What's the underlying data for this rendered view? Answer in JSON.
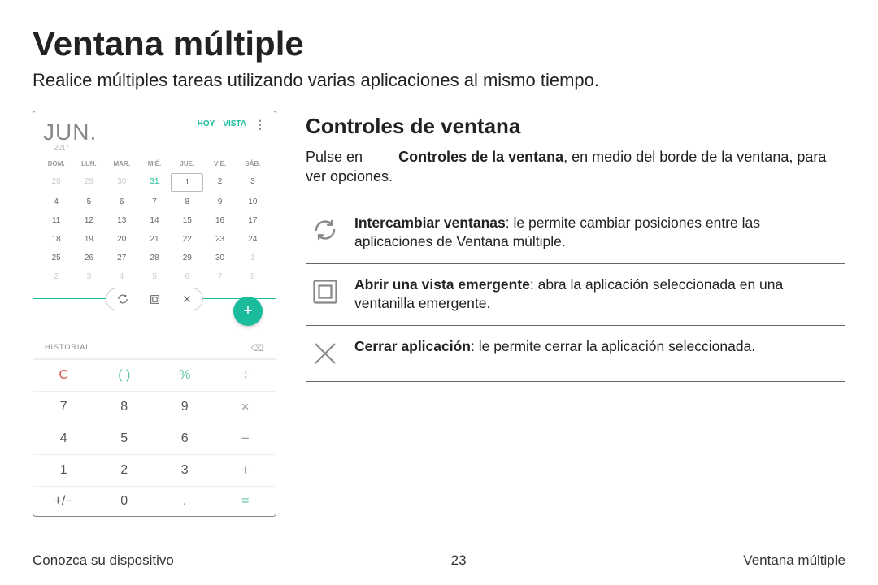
{
  "page": {
    "title": "Ventana múltiple",
    "subtitle": "Realice múltiples tareas utilizando varias aplicaciones al mismo tiempo."
  },
  "section": {
    "title": "Controles de ventana",
    "intro_prefix": "Pulse en ",
    "intro_bold": "Controles de la ventana",
    "intro_suffix": ", en medio del borde de la ventana, para ver opciones."
  },
  "features": [
    {
      "title": "Intercambiar ventanas",
      "desc": ": le permite cambiar posiciones entre las aplicaciones de Ventana múltiple."
    },
    {
      "title": "Abrir una vista emergente",
      "desc": ": abra la aplicación seleccionada en una ventanilla emergente."
    },
    {
      "title": "Cerrar aplicación",
      "desc": ": le permite cerrar la aplicación seleccionada."
    }
  ],
  "phone": {
    "calendar": {
      "month": "JUN.",
      "year": "2017",
      "btn_today": "HOY",
      "btn_view": "VISTA",
      "dow": [
        "DOM.",
        "LUN.",
        "MAR.",
        "MIÉ.",
        "JUE.",
        "VIE.",
        "SÁB."
      ],
      "weeks": [
        [
          "28",
          "29",
          "30",
          "31",
          "1",
          "2",
          "3"
        ],
        [
          "4",
          "5",
          "6",
          "7",
          "8",
          "9",
          "10"
        ],
        [
          "11",
          "12",
          "13",
          "14",
          "15",
          "16",
          "17"
        ],
        [
          "18",
          "19",
          "20",
          "21",
          "22",
          "23",
          "24"
        ],
        [
          "25",
          "26",
          "27",
          "28",
          "29",
          "30",
          "1"
        ],
        [
          "2",
          "3",
          "4",
          "5",
          "6",
          "7",
          "8"
        ]
      ],
      "fab": "+"
    },
    "pill": {
      "swap": "↺",
      "popup": "▣",
      "close": "✕"
    },
    "calculator": {
      "history": "HISTORIAL",
      "keys": [
        [
          "C",
          "( )",
          "%",
          "÷"
        ],
        [
          "7",
          "8",
          "9",
          "×"
        ],
        [
          "4",
          "5",
          "6",
          "−"
        ],
        [
          "1",
          "2",
          "3",
          "+"
        ],
        [
          "+/−",
          "0",
          ".",
          "="
        ]
      ]
    }
  },
  "footer": {
    "left": "Conozca su dispositivo",
    "center": "23",
    "right": "Ventana múltiple"
  }
}
